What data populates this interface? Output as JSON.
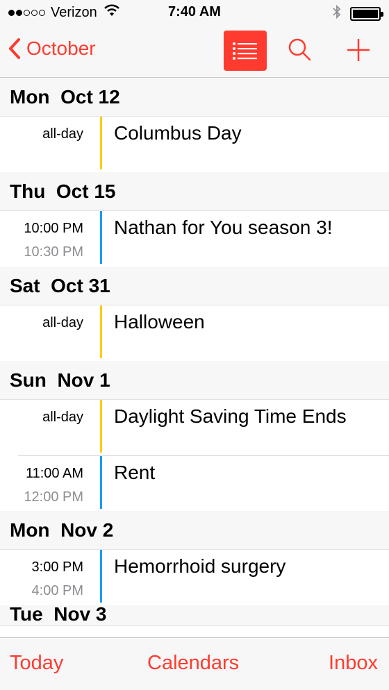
{
  "status_bar": {
    "carrier": "Verizon",
    "time": "7:40 AM",
    "signal_bars_filled": 2,
    "signal_bars_total": 5,
    "battery_level": 1.0,
    "icons": [
      "wifi-icon",
      "bluetooth-icon",
      "battery-icon"
    ]
  },
  "nav": {
    "back_label": "October",
    "buttons": [
      "list-view-icon",
      "search-icon",
      "add-icon"
    ],
    "accent_color": "#ff3b30"
  },
  "days": [
    {
      "header": "Mon  Oct 12",
      "events": [
        {
          "all_day": "all-day",
          "title": "Columbus Day",
          "calendar_color": "#ffcc00"
        }
      ]
    },
    {
      "header": "Thu  Oct 15",
      "events": [
        {
          "start": "10:00 PM",
          "end": "10:30 PM",
          "title": "Nathan for You season 3!",
          "calendar_color": "#1a9bf0"
        }
      ]
    },
    {
      "header": "Sat  Oct 31",
      "events": [
        {
          "all_day": "all-day",
          "title": "Halloween",
          "calendar_color": "#ffcc00"
        }
      ]
    },
    {
      "header": "Sun  Nov 1",
      "events": [
        {
          "all_day": "all-day",
          "title": "Daylight Saving Time Ends",
          "calendar_color": "#ffcc00"
        },
        {
          "start": "11:00 AM",
          "end": "12:00 PM",
          "title": "Rent",
          "calendar_color": "#1a9bf0"
        }
      ]
    },
    {
      "header": "Mon  Nov 2",
      "events": [
        {
          "start": "3:00 PM",
          "end": "4:00 PM",
          "title": "Hemorrhoid surgery",
          "calendar_color": "#1a9bf0"
        }
      ]
    },
    {
      "header": "Tue  Nov 3",
      "events": []
    }
  ],
  "tab_bar": {
    "today": "Today",
    "calendars": "Calendars",
    "inbox": "Inbox"
  }
}
